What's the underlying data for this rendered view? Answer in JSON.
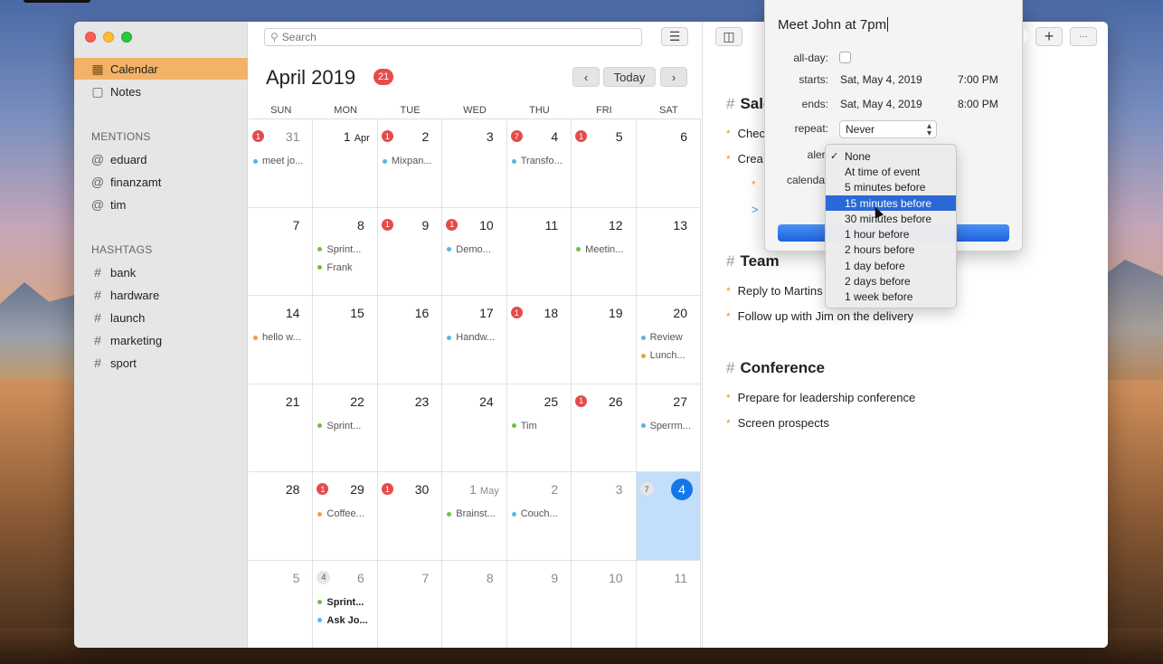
{
  "sidebar": {
    "items": [
      {
        "label": "Calendar",
        "icon": "calendar-icon"
      },
      {
        "label": "Notes",
        "icon": "notes-icon"
      }
    ],
    "mentions_heading": "MENTIONS",
    "mentions": [
      "eduard",
      "finanzamt",
      "tim"
    ],
    "hashtags_heading": "HASHTAGS",
    "hashtags": [
      "bank",
      "hardware",
      "launch",
      "marketing",
      "sport"
    ]
  },
  "calendar": {
    "search_placeholder": "Search",
    "month_title": "April 2019",
    "badge_count": "21",
    "prev_label": "‹",
    "today_label": "Today",
    "next_label": "›",
    "weekdays": [
      "SUN",
      "MON",
      "TUE",
      "WED",
      "THU",
      "FRI",
      "SAT"
    ],
    "weeks": [
      [
        {
          "day": "31",
          "muted": true,
          "badge": "1",
          "events": [
            {
              "t": "meet jo...",
              "c": "#5ab4e5"
            }
          ]
        },
        {
          "day": "1",
          "month": "Apr",
          "events": []
        },
        {
          "day": "2",
          "badge": "1",
          "events": [
            {
              "t": "Mixpan...",
              "c": "#5ab4e5"
            }
          ]
        },
        {
          "day": "3",
          "events": []
        },
        {
          "day": "4",
          "badge": "7",
          "events": [
            {
              "t": "Transfo...",
              "c": "#5ab4e5"
            }
          ]
        },
        {
          "day": "5",
          "badge": "1",
          "events": []
        },
        {
          "day": "6",
          "events": []
        }
      ],
      [
        {
          "day": "7",
          "events": []
        },
        {
          "day": "8",
          "events": [
            {
              "t": "Sprint...",
              "c": "#6cc04a"
            },
            {
              "t": "Frank",
              "c": "#6cc04a"
            }
          ]
        },
        {
          "day": "9",
          "badge": "1",
          "events": []
        },
        {
          "day": "10",
          "badge": "1",
          "events": [
            {
              "t": "Demo...",
              "c": "#5ab4e5"
            }
          ]
        },
        {
          "day": "11",
          "events": []
        },
        {
          "day": "12",
          "events": [
            {
              "t": "Meetin...",
              "c": "#6cc04a"
            }
          ]
        },
        {
          "day": "13",
          "events": []
        }
      ],
      [
        {
          "day": "14",
          "events": [
            {
              "t": "hello w...",
              "c": "#f0a040"
            }
          ]
        },
        {
          "day": "15",
          "events": []
        },
        {
          "day": "16",
          "events": []
        },
        {
          "day": "17",
          "events": [
            {
              "t": "Handw...",
              "c": "#5ab4e5"
            }
          ]
        },
        {
          "day": "18",
          "badge": "1",
          "events": []
        },
        {
          "day": "19",
          "events": []
        },
        {
          "day": "20",
          "events": [
            {
              "t": "Review",
              "c": "#5ab4e5"
            },
            {
              "t": "Lunch...",
              "c": "#f0a040"
            }
          ]
        }
      ],
      [
        {
          "day": "21",
          "events": []
        },
        {
          "day": "22",
          "events": [
            {
              "t": "Sprint...",
              "c": "#6cc04a"
            }
          ]
        },
        {
          "day": "23",
          "events": []
        },
        {
          "day": "24",
          "events": []
        },
        {
          "day": "25",
          "events": [
            {
              "t": "Tim",
              "c": "#6cc04a"
            }
          ]
        },
        {
          "day": "26",
          "badge": "1",
          "events": []
        },
        {
          "day": "27",
          "events": [
            {
              "t": "Sperrm...",
              "c": "#5ab4e5"
            }
          ]
        }
      ],
      [
        {
          "day": "28",
          "events": []
        },
        {
          "day": "29",
          "badge": "1",
          "events": [
            {
              "t": "Coffee...",
              "c": "#f0a040"
            }
          ]
        },
        {
          "day": "30",
          "badge": "1",
          "events": []
        },
        {
          "day": "1",
          "month": "May",
          "muted": true,
          "events": [
            {
              "t": "Brainst...",
              "c": "#6cc04a"
            }
          ]
        },
        {
          "day": "2",
          "muted": true,
          "events": [
            {
              "t": "Couch...",
              "c": "#5ab4e5"
            }
          ]
        },
        {
          "day": "3",
          "muted": true,
          "events": []
        },
        {
          "day": "4",
          "today": true,
          "grey_badge": "7",
          "events": []
        }
      ],
      [
        {
          "day": "5",
          "muted": true,
          "events": []
        },
        {
          "day": "6",
          "muted": true,
          "grey_badge": "4",
          "events": [
            {
              "t": "Sprint...",
              "c": "#6cc04a",
              "bold": true
            },
            {
              "t": "Ask Jo...",
              "c": "#5ab4e5",
              "bold": true
            }
          ]
        },
        {
          "day": "7",
          "muted": true,
          "events": []
        },
        {
          "day": "8",
          "muted": true,
          "events": []
        },
        {
          "day": "9",
          "muted": true,
          "events": []
        },
        {
          "day": "10",
          "muted": true,
          "events": []
        },
        {
          "day": "11",
          "muted": true,
          "events": []
        }
      ]
    ]
  },
  "notes": {
    "add_label": "+",
    "more_label": "···",
    "sections": [
      {
        "heading": "Sale",
        "items": [
          "Chec",
          "Crea"
        ]
      },
      {
        "heading": "Team",
        "items": [
          "Reply to Martins",
          "Follow up with Jim on the delivery"
        ]
      },
      {
        "heading": "Conference",
        "items": [
          "Prepare for leadership conference",
          "Screen prospects"
        ]
      }
    ],
    "sub_star": "*",
    "sub_arrow": ">",
    "hash": "#"
  },
  "popover": {
    "title": "Meet John at 7pm",
    "allday_label": "all-day:",
    "starts_label": "starts:",
    "starts_date": "Sat, May 4, 2019",
    "starts_time": "7:00 PM",
    "ends_label": "ends:",
    "ends_date": "Sat, May 4, 2019",
    "ends_time": "8:00 PM",
    "repeat_label": "repeat:",
    "repeat_value": "Never",
    "alert_label": "alert",
    "calendar_label": "calendar"
  },
  "alert_options": {
    "items": [
      "None",
      "At time of event",
      "5 minutes before",
      "15 minutes before",
      "30 minutes before",
      "1 hour before",
      "2 hours before",
      "1 day before",
      "2 days before",
      "1 week before"
    ],
    "checked": "None",
    "highlighted": "15 minutes before",
    "check_glyph": "✓"
  }
}
